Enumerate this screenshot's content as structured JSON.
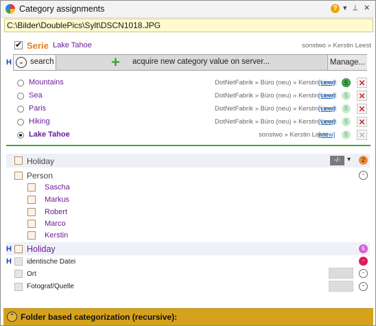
{
  "window": {
    "title": "Category assignments",
    "help_glyph": "?",
    "menu_glyph": "▾",
    "pin_glyph": "⊥",
    "close_glyph": "✕"
  },
  "path": "C:\\Bilder\\DoublePics\\Sylt\\DSCN1018.JPG",
  "serie": {
    "label": "Serie",
    "value": "Lake Tahoe",
    "meta": "sonstwo » Kerstin Leest",
    "checked": true
  },
  "toolbar": {
    "h_marker": "H",
    "search_label": "search",
    "acquire_label": "acquire new category value on server...",
    "manage_label": "Manage..."
  },
  "values": [
    {
      "name": "Mountains",
      "meta": "DotNetFabrik » Büro (neu) » Kerstin Leest",
      "view": "[view]",
      "count": "5",
      "selected": false
    },
    {
      "name": "Sea",
      "meta": "DotNetFabrik » Büro (neu) » Kerstin Leest",
      "view": "[view]",
      "count": "5",
      "selected": false
    },
    {
      "name": "Paris",
      "meta": "DotNetFabrik » Büro (neu) » Kerstin Leest",
      "view": "[view]",
      "count": "5",
      "selected": false
    },
    {
      "name": "Hiking",
      "meta": "DotNetFabrik » Büro (neu) » Kerstin Leest",
      "view": "[view]",
      "count": "5",
      "selected": false
    },
    {
      "name": "Lake Tahoe",
      "meta": "sonstwo » Kerstin Leest",
      "view": "[view]",
      "count": "5",
      "selected": true
    }
  ],
  "categories": {
    "holiday_group": {
      "label": "Holiday",
      "slash_label": "-/-",
      "count": "2"
    },
    "person": {
      "label": "Person",
      "badge": "-",
      "children": [
        "Sascha",
        "Markus",
        "Robert",
        "Marco",
        "Kerstin"
      ]
    },
    "holiday_h": {
      "marker": "H",
      "label": "Holiday",
      "count": "6"
    },
    "identische": {
      "marker": "H",
      "label": "identische Datei",
      "badge": "-"
    },
    "ort": {
      "label": "Ort",
      "badge": "-"
    },
    "fotograf": {
      "label": "Fotograf/Quelle",
      "badge": "-"
    }
  },
  "footer": {
    "label": "Folder based categorization (recursive):",
    "chevron": "⌃"
  },
  "colors": {
    "accent_green": "#3aa83a",
    "serie_orange": "#e67e22",
    "value_purple": "#6a1b9a",
    "footer_gold": "#d4a21c"
  }
}
